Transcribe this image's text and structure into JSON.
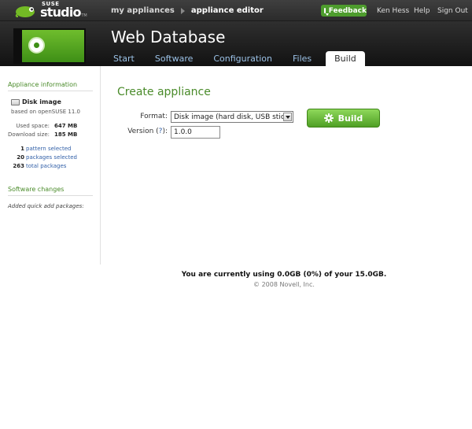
{
  "topbar": {
    "logo_suse": "SUSE",
    "logo_studio": "studio",
    "logo_tm": "TM",
    "breadcrumbs": [
      "my appliances",
      "appliance editor"
    ],
    "feedback_label": "Feedback",
    "user_name": "Ken Hess",
    "help_label": "Help",
    "signout_label": "Sign Out"
  },
  "header": {
    "app_title": "Web Database",
    "tabs": [
      {
        "label": "Start"
      },
      {
        "label": "Software"
      },
      {
        "label": "Configuration"
      },
      {
        "label": "Files"
      },
      {
        "label": "Build",
        "active": true
      }
    ]
  },
  "sidebar": {
    "info_heading": "Appliance information",
    "image_type": "Disk image",
    "based_on": "based on openSUSE 11.0",
    "used_space_label": "Used space:",
    "used_space_value": "647 MB",
    "download_size_label": "Download size:",
    "download_size_value": "185 MB",
    "counts": [
      {
        "num": "1",
        "label": "pattern selected"
      },
      {
        "num": "20",
        "label": "packages selected"
      },
      {
        "num": "263",
        "label": "total packages"
      }
    ],
    "changes_heading": "Software changes",
    "changes_text": "Added quick add packages:"
  },
  "main": {
    "title": "Create appliance",
    "format_label": "Format:",
    "format_value": "Disk image (hard disk, USB stick)",
    "version_label": "Version",
    "version_help": "?",
    "version_value": "1.0.0",
    "build_label": "Build"
  },
  "footer": {
    "usage": "You are currently using 0.0GB (0%) of your 15.0GB.",
    "copyright": "© 2008 Novell, Inc."
  },
  "colors": {
    "accent_green": "#4a8b2a",
    "link_blue": "#3260a8",
    "tab_blue": "#9bc1e6"
  }
}
